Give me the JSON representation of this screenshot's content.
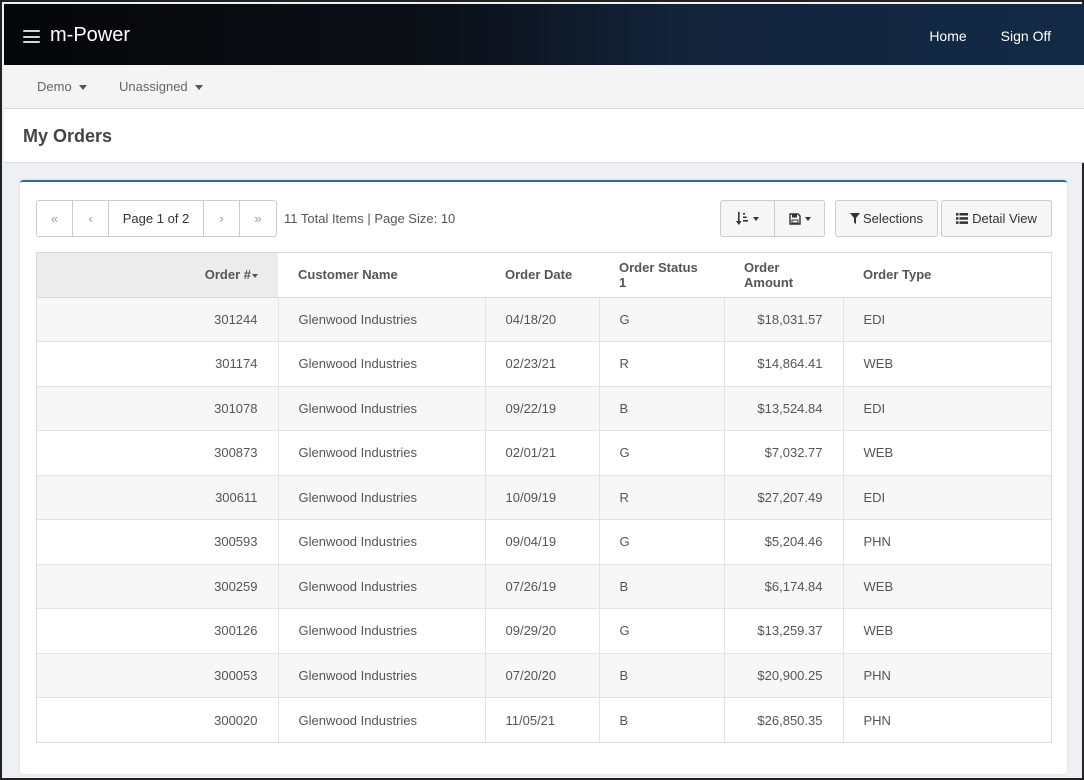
{
  "app": {
    "brand": "m-Power"
  },
  "topnav": {
    "home": "Home",
    "sign_off": "Sign Off"
  },
  "subnav": {
    "demo": "Demo",
    "unassigned": "Unassigned"
  },
  "page": {
    "title": "My Orders"
  },
  "pager": {
    "first": "«",
    "prev": "‹",
    "page_label": "Page 1 of 2",
    "next": "›",
    "last": "»",
    "info": "11 Total Items | Page Size: 10"
  },
  "toolbar": {
    "sort_icon": "sort-amount-icon",
    "save_icon": "floppy-disk-icon",
    "selections_label": "Selections",
    "selections_icon": "filter-icon",
    "detail_view_label": "Detail View",
    "detail_view_icon": "list-icon"
  },
  "table": {
    "columns": [
      "Order #",
      "Customer Name",
      "Order Date",
      "Order Status 1",
      "Order Amount",
      "Order Type"
    ],
    "sorted_column": "Order #",
    "rows": [
      [
        "301244",
        "Glenwood Industries",
        "04/18/20",
        "G",
        "$18,031.57",
        "EDI"
      ],
      [
        "301174",
        "Glenwood Industries",
        "02/23/21",
        "R",
        "$14,864.41",
        "WEB"
      ],
      [
        "301078",
        "Glenwood Industries",
        "09/22/19",
        "B",
        "$13,524.84",
        "EDI"
      ],
      [
        "300873",
        "Glenwood Industries",
        "02/01/21",
        "G",
        "$7,032.77",
        "WEB"
      ],
      [
        "300611",
        "Glenwood Industries",
        "10/09/19",
        "R",
        "$27,207.49",
        "EDI"
      ],
      [
        "300593",
        "Glenwood Industries",
        "09/04/19",
        "G",
        "$5,204.46",
        "PHN"
      ],
      [
        "300259",
        "Glenwood Industries",
        "07/26/19",
        "B",
        "$6,174.84",
        "WEB"
      ],
      [
        "300126",
        "Glenwood Industries",
        "09/29/20",
        "G",
        "$13,259.37",
        "WEB"
      ],
      [
        "300053",
        "Glenwood Industries",
        "07/20/20",
        "B",
        "$20,900.25",
        "PHN"
      ],
      [
        "300020",
        "Glenwood Industries",
        "11/05/21",
        "B",
        "$26,850.35",
        "PHN"
      ]
    ]
  }
}
